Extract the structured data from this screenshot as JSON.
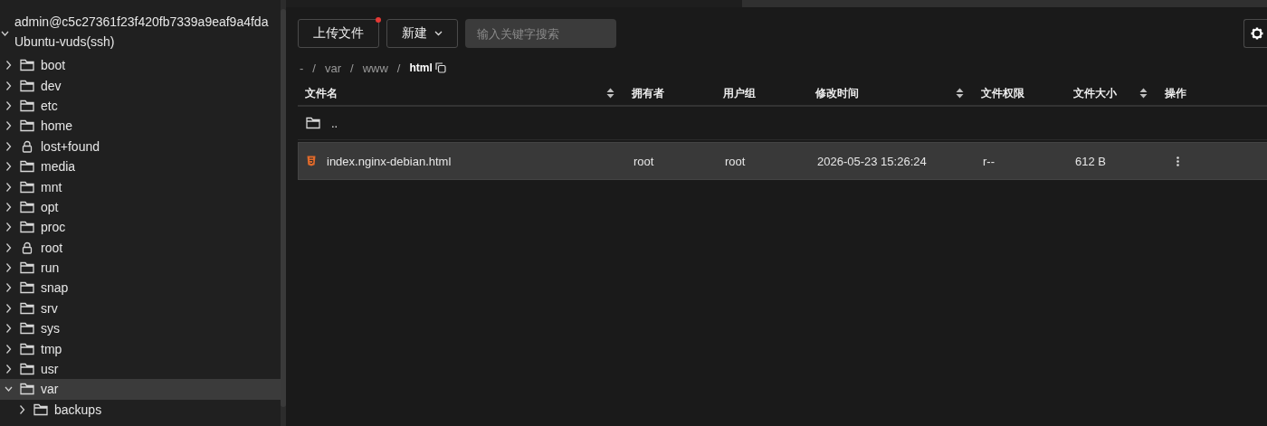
{
  "sidebar": {
    "user": "admin@c5c27361f23f420fb7339a9eaf9a4fda",
    "connection": {
      "label": "Ubuntu-vuds(ssh)",
      "expanded": true
    },
    "tree": [
      {
        "label": "boot",
        "kind": "folder",
        "expanded": false,
        "selected": false
      },
      {
        "label": "dev",
        "kind": "folder",
        "expanded": false,
        "selected": false
      },
      {
        "label": "etc",
        "kind": "folder",
        "expanded": false,
        "selected": false
      },
      {
        "label": "home",
        "kind": "folder",
        "expanded": false,
        "selected": false
      },
      {
        "label": "lost+found",
        "kind": "locked",
        "expanded": false,
        "selected": false
      },
      {
        "label": "media",
        "kind": "folder",
        "expanded": false,
        "selected": false
      },
      {
        "label": "mnt",
        "kind": "folder",
        "expanded": false,
        "selected": false
      },
      {
        "label": "opt",
        "kind": "folder",
        "expanded": false,
        "selected": false
      },
      {
        "label": "proc",
        "kind": "folder",
        "expanded": false,
        "selected": false
      },
      {
        "label": "root",
        "kind": "locked",
        "expanded": false,
        "selected": false
      },
      {
        "label": "run",
        "kind": "folder",
        "expanded": false,
        "selected": false
      },
      {
        "label": "snap",
        "kind": "folder",
        "expanded": false,
        "selected": false
      },
      {
        "label": "srv",
        "kind": "folder",
        "expanded": false,
        "selected": false
      },
      {
        "label": "sys",
        "kind": "folder",
        "expanded": false,
        "selected": false
      },
      {
        "label": "tmp",
        "kind": "folder",
        "expanded": false,
        "selected": false
      },
      {
        "label": "usr",
        "kind": "folder",
        "expanded": false,
        "selected": false
      },
      {
        "label": "var",
        "kind": "folder",
        "expanded": true,
        "selected": true,
        "children": [
          {
            "label": "backups",
            "kind": "folder",
            "expanded": false,
            "selected": false
          }
        ]
      }
    ]
  },
  "toolbar": {
    "upload": {
      "label": "上传文件",
      "notification_dot": true
    },
    "new": {
      "label": "新建"
    },
    "search": {
      "placeholder": "输入关键字搜索"
    }
  },
  "breadcrumb": {
    "separator": "/",
    "items": [
      "-",
      "var",
      "www",
      "html"
    ]
  },
  "table": {
    "columns": [
      {
        "label": "文件名",
        "sortable": true
      },
      {
        "label": "拥有者",
        "sortable": false
      },
      {
        "label": "用户组",
        "sortable": false
      },
      {
        "label": "修改时间",
        "sortable": true
      },
      {
        "label": "文件权限",
        "sortable": false
      },
      {
        "label": "文件大小",
        "sortable": true
      },
      {
        "label": "操作",
        "sortable": false
      }
    ],
    "parent_row": {
      "name": ".."
    },
    "rows": [
      {
        "kind": "html",
        "name": "index.nginx-debian.html",
        "owner": "root",
        "group": "root",
        "modified": "2026-05-23 15:26:24",
        "permissions": "r--",
        "size": "612 B",
        "selected": true
      }
    ]
  }
}
